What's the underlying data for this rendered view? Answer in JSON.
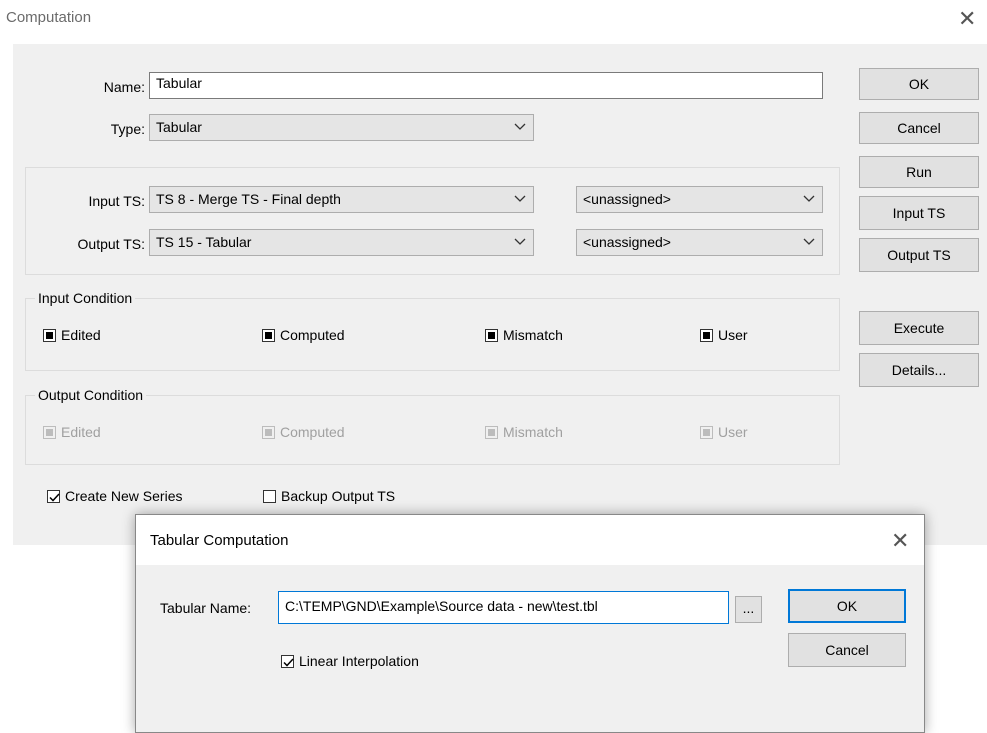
{
  "window": {
    "title": "Computation"
  },
  "fields": {
    "name_label": "Name:",
    "name_value": "Tabular",
    "type_label": "Type:",
    "type_value": "Tabular",
    "input_ts_label": "Input TS:",
    "input_ts_value": "TS 8 - Merge TS -  Final depth",
    "input_ts_extra": "<unassigned>",
    "output_ts_label": "Output TS:",
    "output_ts_value": "TS 15 - Tabular",
    "output_ts_extra": "<unassigned>"
  },
  "input_condition": {
    "title": "Input Condition",
    "items": [
      "Edited",
      "Computed",
      "Mismatch",
      "User"
    ]
  },
  "output_condition": {
    "title": "Output Condition",
    "items": [
      "Edited",
      "Computed",
      "Mismatch",
      "User"
    ]
  },
  "options": {
    "create_new_series": "Create New Series",
    "backup_output_ts": "Backup Output TS"
  },
  "buttons": {
    "ok": "OK",
    "cancel": "Cancel",
    "run": "Run",
    "input_ts": "Input TS",
    "output_ts": "Output TS",
    "execute": "Execute",
    "details": "Details..."
  },
  "tabular_dialog": {
    "title": "Tabular Computation",
    "name_label": "Tabular Name:",
    "name_value": "C:\\TEMP\\GND\\Example\\Source data - new\\test.tbl",
    "browse": "...",
    "linear_interpolation": "Linear Interpolation",
    "ok": "OK",
    "cancel": "Cancel"
  }
}
